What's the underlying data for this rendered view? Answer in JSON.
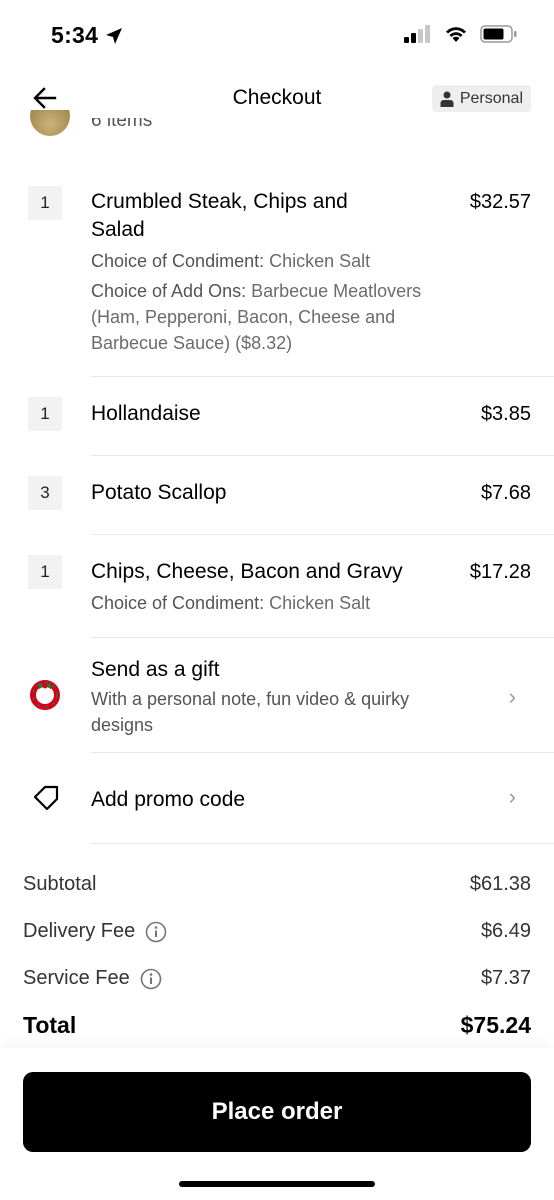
{
  "status_bar": {
    "time": "5:34"
  },
  "header": {
    "title": "Checkout",
    "profile_label": "Personal"
  },
  "store": {
    "items_count": "6 items"
  },
  "cart_items": [
    {
      "qty": "1",
      "name_line1": "Crumbled Steak, Chips and",
      "name_line2": "Salad",
      "price": "$32.57",
      "opt1_label": "Choice of Condiment:",
      "opt1_value": " Chicken Salt",
      "opt2_label": "Choice of Add Ons:",
      "opt2_value": " Barbecue Meatlovers (Ham, Pepperoni, Bacon, Cheese and Barbecue Sauce) ($8.32)"
    },
    {
      "qty": "1",
      "name": "Hollandaise",
      "price": "$3.85"
    },
    {
      "qty": "3",
      "name": "Potato Scallop",
      "price": "$7.68"
    },
    {
      "qty": "1",
      "name": "Chips, Cheese, Bacon and Gravy",
      "price": "$17.28",
      "opt1_label": "Choice of Condiment:",
      "opt1_value": " Chicken Salt"
    }
  ],
  "gift": {
    "title": "Send as a gift",
    "subtitle": "With a personal note, fun video & quirky designs",
    "icon": "gift-wreath-icon"
  },
  "promo": {
    "title": "Add promo code",
    "icon": "tag-icon"
  },
  "totals": {
    "subtotal_label": "Subtotal",
    "subtotal_value": "$61.38",
    "delivery_label": "Delivery Fee",
    "delivery_value": "$6.49",
    "service_label": "Service Fee",
    "service_value": "$7.37",
    "total_label": "Total",
    "total_value": "$75.24"
  },
  "cta": {
    "place_order_label": "Place order"
  },
  "colors": {
    "primary": "#000000",
    "qty_bg": "#f2f2f2",
    "muted_text": "#6b6b6b",
    "gift_red": "#d6001c"
  }
}
